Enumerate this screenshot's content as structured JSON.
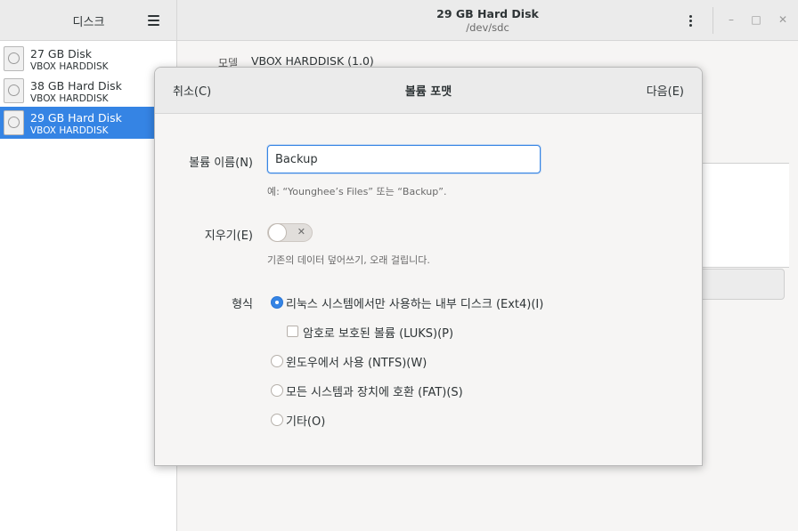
{
  "sidebar": {
    "title": "디스크",
    "disks": [
      {
        "name": "27 GB Disk",
        "model": "VBOX HARDDISK",
        "selected": false
      },
      {
        "name": "38 GB Hard Disk",
        "model": "VBOX HARDDISK",
        "selected": false
      },
      {
        "name": "29 GB Hard Disk",
        "model": "VBOX HARDDISK",
        "selected": true
      }
    ]
  },
  "header": {
    "title": "29 GB Hard Disk",
    "subtitle": "/dev/sdc"
  },
  "main": {
    "model_label": "모델",
    "model_value": "VBOX HARDDISK (1.0)"
  },
  "dialog": {
    "title": "볼륨 포맷",
    "cancel_label": "취소(C)",
    "next_label": "다음(E)",
    "volume_name_label": "볼륨 이름(N)",
    "volume_name_value": "Backup",
    "volume_name_hint": "예: “Younghee’s Files” 또는 “Backup”.",
    "erase_label": "지우기(E)",
    "erase_on": false,
    "erase_hint": "기존의 데이터 덮어쓰기, 오래 걸립니다.",
    "type_label": "형식",
    "options": {
      "ext4": "리눅스 시스템에서만 사용하는 내부 디스크 (Ext4)(I)",
      "luks": "암호로 보호된 볼륨 (LUKS)(P)",
      "ntfs": "윈도우에서 사용 (NTFS)(W)",
      "fat": "모든 시스템과 장치에 호환 (FAT)(S)",
      "other": "기타(O)"
    },
    "selected_option": "ext4"
  },
  "colors": {
    "accent": "#3584e4",
    "header_bg": "#ebebeb",
    "window_bg": "#f6f5f4"
  }
}
